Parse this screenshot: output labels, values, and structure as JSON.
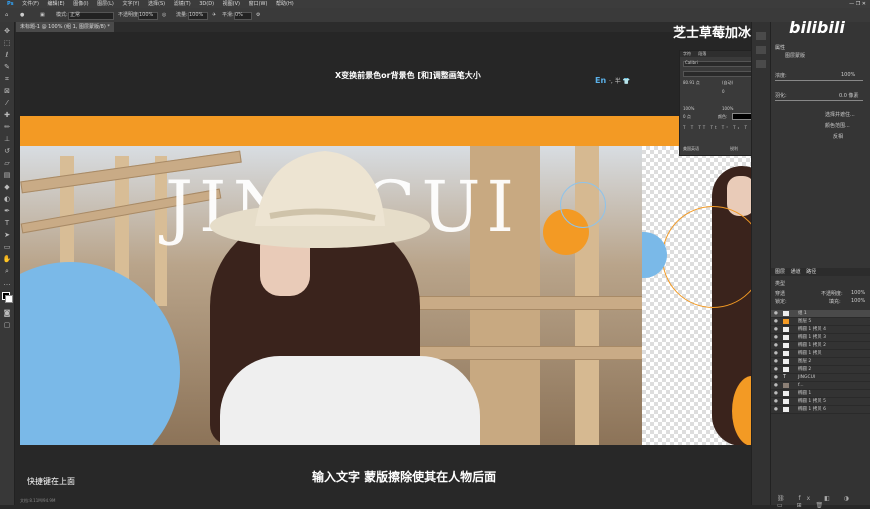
{
  "menu": {
    "items": [
      "文件(F)",
      "编辑(E)",
      "图像(I)",
      "图层(L)",
      "文字(Y)",
      "选择(S)",
      "滤镜(T)",
      "3D(D)",
      "视图(V)",
      "窗口(W)",
      "帮助(H)"
    ],
    "window_controls": "—  ❐  ✕"
  },
  "options": {
    "mode_label": "模式:",
    "mode_value": "正常",
    "opacity_label": "不透明度:",
    "opacity_value": "100%",
    "flow_label": "流量:",
    "flow_value": "100%",
    "smooth_label": "平滑:",
    "smooth_value": "0%"
  },
  "document_tab": "未标题-1 @ 100% (组 1, 图层蒙版/8) *",
  "canvas": {
    "hint_text": "X变换前景色or背景色 [和]调整画笔大小",
    "ime_en": "En",
    "ime_rest": "·, 半 👕",
    "big_letters": "JINGCUI"
  },
  "subtitle": "输入文字 蒙版擦除使其在人物后面",
  "shortcut_note": "快捷键在上面",
  "status_text": "文档:8.11M/94.9M",
  "watermark": "芝士草莓加冰",
  "watermark_logo": "bilibili",
  "character_panel": {
    "tabs": [
      "字符",
      "段落"
    ],
    "font": "Calibri",
    "size_a": "80.91 点",
    "size_b": "(自动)",
    "tracking": "0",
    "scale_v": "100%",
    "scale_h": "100%",
    "baseline": "0 点",
    "color_label": "颜色:",
    "lang": "美国英语",
    "aa": "锐利"
  },
  "properties": {
    "title": "属性",
    "sub": "图层蒙版",
    "density_label": "浓度:",
    "density_value": "100%",
    "feather_label": "羽化:",
    "feather_value": "0.0 像素",
    "btn_select": "选择并遮住...",
    "btn_color": "颜色范围...",
    "btn_invert": "反相"
  },
  "layers_panel": {
    "tabs": [
      "图层",
      "通道",
      "路径"
    ],
    "filter": "类型",
    "blend": "穿透",
    "opacity_label": "不透明度:",
    "opacity_value": "100%",
    "lock_label": "锁定:",
    "fill_label": "填充:",
    "fill_value": "100%",
    "layers": [
      {
        "name": "组 1"
      },
      {
        "name": "图层 5"
      },
      {
        "name": "椭圆 1 拷贝 4"
      },
      {
        "name": "椭圆 1 拷贝 3"
      },
      {
        "name": "椭圆 1 拷贝 2"
      },
      {
        "name": "椭圆 1 拷贝"
      },
      {
        "name": "图层 2"
      },
      {
        "name": "椭圆 2"
      },
      {
        "name": "JINGCUI"
      },
      {
        "name": "f..."
      },
      {
        "name": "椭圆 1"
      },
      {
        "name": "椭圆 1 拷贝 5"
      },
      {
        "name": "椭圆 1 拷贝 6"
      }
    ]
  },
  "colors": {
    "accent_orange": "#f39a24",
    "accent_blue": "#7ab9e8"
  }
}
